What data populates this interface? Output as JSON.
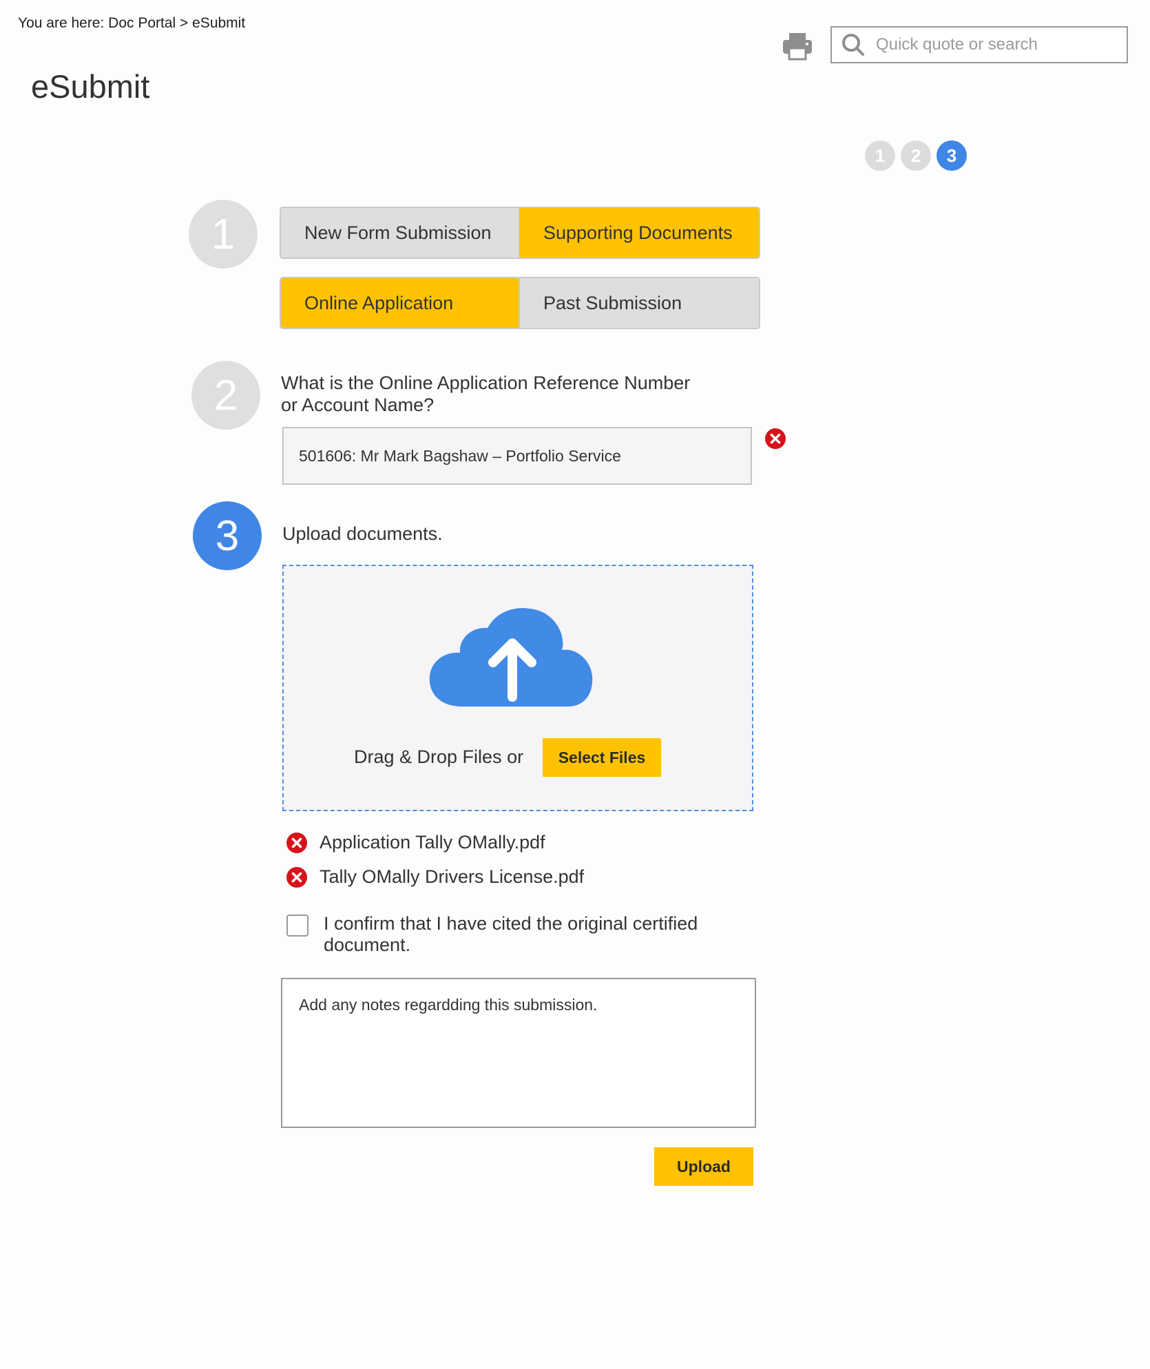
{
  "breadcrumb": {
    "text": "You are here: Doc Portal > eSubmit"
  },
  "header": {
    "title": "eSubmit",
    "search_placeholder": "Quick quote or search"
  },
  "progress": {
    "steps": [
      "1",
      "2",
      "3"
    ],
    "current": 3
  },
  "step1": {
    "number": "1",
    "options_row1": [
      "New Form Submission",
      "Supporting Documents"
    ],
    "options_row2": [
      "Online Application",
      "Past Submission"
    ],
    "selected": [
      "Supporting Documents",
      "Online Application"
    ]
  },
  "step2": {
    "number": "2",
    "question_line1": "What is the Online Application Reference Number",
    "question_line2": "or Account Name?",
    "value": "501606: Mr Mark Bagshaw – Portfolio Service"
  },
  "step3": {
    "number": "3",
    "label": "Upload documents.",
    "drag_text": "Drag & Drop Files or",
    "select_files": "Select Files",
    "files": [
      "Application Tally OMally.pdf",
      "Tally OMally Drivers License.pdf"
    ],
    "confirm_text": "I confirm that I have cited the original certified document.",
    "confirm_checked": false,
    "notes_placeholder": "Add any notes regardding this submission.",
    "upload_button": "Upload"
  },
  "colors": {
    "accent": "#ffc200",
    "active_step": "#3f86e6",
    "remove_icon": "#d7121b"
  }
}
